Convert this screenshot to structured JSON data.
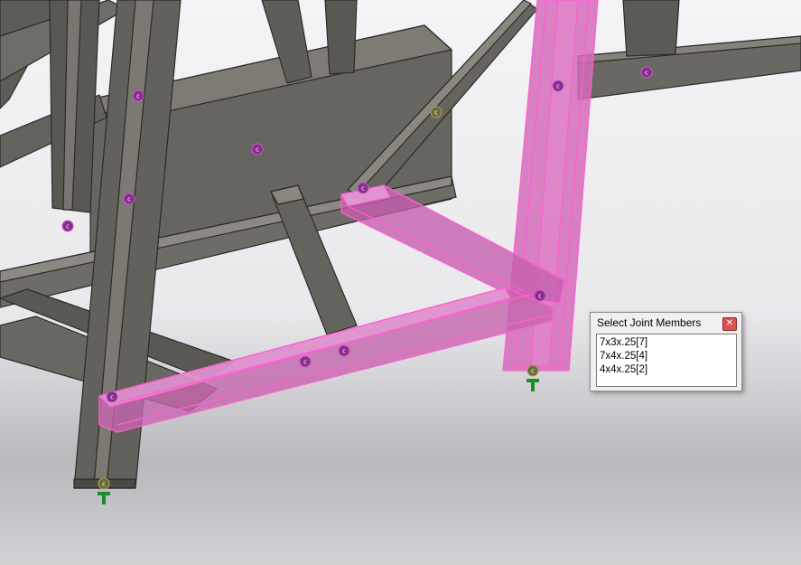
{
  "dialog": {
    "title": "Select Joint Members",
    "close_icon": "close-icon",
    "items": [
      "7x3x.25[7]",
      "7x4x.25[4]",
      "4x4x.25[2]"
    ]
  },
  "marker": {
    "glyph": "c"
  },
  "colors": {
    "steel": "#5f5d58",
    "steel_dark": "#3f3d39",
    "steel_light": "#8a8780",
    "highlight": "#e07ac4",
    "highlight_edge": "#ff5fd3",
    "marker_purple": "#8a2a8f",
    "marker_olive": "#6d6a38",
    "anchor_green": "#1e8a2e"
  }
}
